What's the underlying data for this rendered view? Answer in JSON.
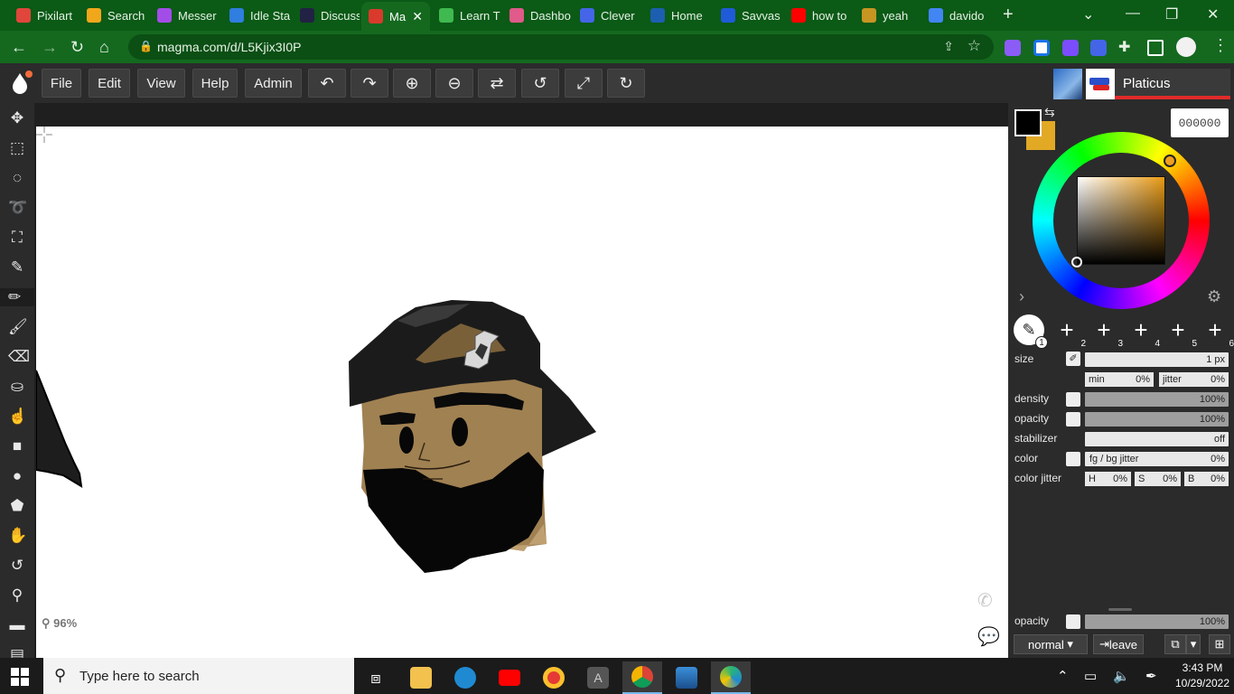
{
  "browser": {
    "tabs": [
      {
        "label": "Pixilart",
        "color": "#e0463c"
      },
      {
        "label": "Search",
        "color": "#f2a71b"
      },
      {
        "label": "Messer",
        "color": "#a34de8"
      },
      {
        "label": "Idle Sta",
        "color": "#2f7ee0"
      },
      {
        "label": "Discuss",
        "color": "#222244"
      },
      {
        "label": "Ma",
        "color": "#d93a2b",
        "active": true
      },
      {
        "label": "Learn T",
        "color": "#3fb950"
      },
      {
        "label": "Dashbo",
        "color": "#e05a8a"
      },
      {
        "label": "Clever",
        "color": "#4465e8"
      },
      {
        "label": "Home",
        "color": "#1c5fb0"
      },
      {
        "label": "Savvas",
        "color": "#1f5bd8"
      },
      {
        "label": "how to",
        "color": "#ff0000"
      },
      {
        "label": "yeah",
        "color": "#c79522"
      },
      {
        "label": "davido",
        "color": "#4285f4"
      }
    ],
    "url": "magma.com/d/L5Kjix3I0P"
  },
  "app": {
    "menu": [
      "File",
      "Edit",
      "View",
      "Help",
      "Admin"
    ],
    "toolbar_icons": [
      "undo-icon",
      "redo-icon",
      "zoom-in-icon",
      "zoom-out-icon",
      "flip-icon",
      "rotate-left-icon",
      "fullscreen-icon",
      "rotate-right-icon"
    ],
    "user": {
      "name": "Platicus"
    },
    "zoom": "96%"
  },
  "tools": [
    "move-icon",
    "rect-select-icon",
    "ellipse-select-icon",
    "lasso-icon",
    "transform-icon",
    "eyedropper-icon",
    "pencil-icon",
    "brush-icon",
    "eraser-icon",
    "fill-icon",
    "smudge-icon",
    "rectangle-icon",
    "ellipse-icon",
    "shape-icon",
    "hand-icon",
    "rotate-view-icon",
    "zoom-icon",
    "ruler-icon",
    "filmstrip-icon"
  ],
  "color": {
    "hex": "000000",
    "fg": "#000000",
    "bg": "#e2a925"
  },
  "brush_slots": [
    "1",
    "2",
    "3",
    "4",
    "5",
    "6"
  ],
  "settings": {
    "size_label": "size",
    "size_value": "1 px",
    "min_label": "min",
    "min_value": "0%",
    "jitter_label": "jitter",
    "jitter_value": "0%",
    "density_label": "density",
    "density_value": "100%",
    "opacity_label": "opacity",
    "opacity_value": "100%",
    "stabilizer_label": "stabilizer",
    "stabilizer_value": "off",
    "color_label": "color",
    "fgbg_label": "fg / bg jitter",
    "fgbg_value": "0%",
    "colorjitter_label": "color jitter",
    "h_label": "H",
    "h_value": "0%",
    "s_label": "S",
    "s_value": "0%",
    "b_label": "B",
    "b_value": "0%",
    "layer_opacity_label": "opacity",
    "layer_opacity_value": "100%",
    "blend_mode": "normal",
    "leave_label": "leave"
  },
  "taskbar": {
    "search_placeholder": "Type here to search",
    "time": "3:43 PM",
    "date": "10/29/2022"
  }
}
